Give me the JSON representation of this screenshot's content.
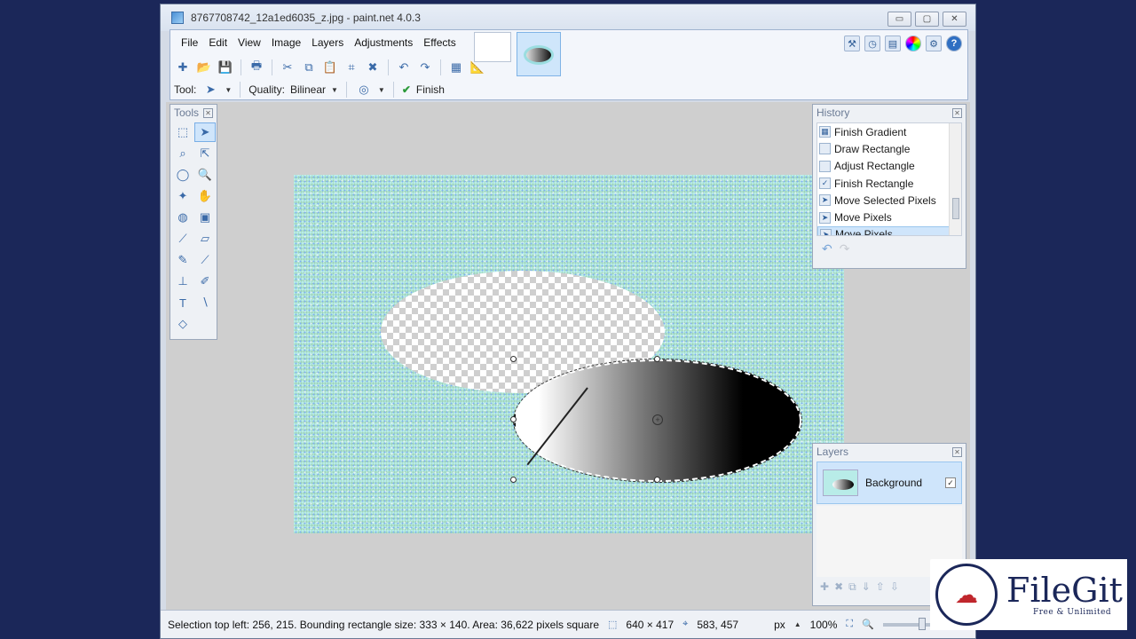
{
  "window": {
    "title": "8767708742_12a1ed6035_z.jpg - paint.net 4.0.3",
    "minimize": "▭",
    "maximize": "▢",
    "close": "✕"
  },
  "menu": [
    "File",
    "Edit",
    "View",
    "Image",
    "Layers",
    "Adjustments",
    "Effects"
  ],
  "options": {
    "tool_label": "Tool:",
    "quality_label": "Quality:",
    "quality_value": "Bilinear",
    "finish_label": "Finish"
  },
  "tools_panel": {
    "title": "Tools"
  },
  "history_panel": {
    "title": "History",
    "items": [
      {
        "label": "Finish Gradient",
        "icon": "gradient-icon"
      },
      {
        "label": "Draw Rectangle",
        "icon": "rectangle-icon"
      },
      {
        "label": "Adjust Rectangle",
        "icon": "rectangle-icon"
      },
      {
        "label": "Finish Rectangle",
        "icon": "finish-icon"
      },
      {
        "label": "Move Selected Pixels",
        "icon": "move-icon"
      },
      {
        "label": "Move Pixels",
        "icon": "move-icon"
      },
      {
        "label": "Move Pixels",
        "icon": "move-icon",
        "selected": true
      }
    ],
    "undo": "↶",
    "redo": "↷"
  },
  "layers_panel": {
    "title": "Layers",
    "layers": [
      {
        "name": "Background",
        "visible": true
      }
    ]
  },
  "status": {
    "selection_text": "Selection top left: 256, 215. Bounding rectangle size: 333 × 140. Area: 36,622 pixels square",
    "image_size": "640 × 417",
    "cursor_pos": "583, 457",
    "units": "px",
    "zoom": "100%"
  },
  "watermark": {
    "name": "FileGit",
    "tagline": "Free & Unlimited"
  },
  "colors": {
    "desktop": "#1b2759",
    "accent": "#3a6aa8",
    "selection": "#cfe5fb"
  }
}
